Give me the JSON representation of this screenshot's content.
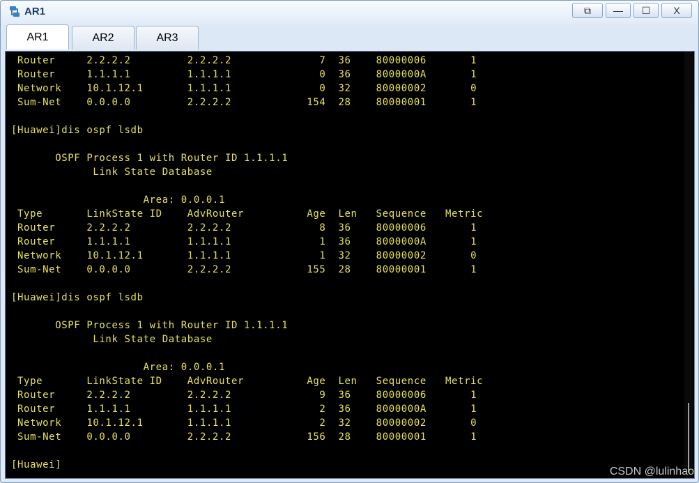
{
  "window": {
    "title": "AR1"
  },
  "controls": {
    "restore": "⧉",
    "minimize": "—",
    "maximize": "☐",
    "close": "X"
  },
  "tabs": [
    {
      "label": "AR1"
    },
    {
      "label": "AR2"
    },
    {
      "label": "AR3"
    }
  ],
  "terminal": {
    "lines": [
      " Router     2.2.2.2         2.2.2.2              7  36    80000006       1",
      " Router     1.1.1.1         1.1.1.1              0  36    8000000A       1",
      " Network    10.1.12.1       1.1.1.1              0  32    80000002       0",
      " Sum-Net    0.0.0.0         2.2.2.2            154  28    80000001       1",
      "",
      "[Huawei]dis ospf lsdb",
      "",
      "       OSPF Process 1 with Router ID 1.1.1.1",
      "             Link State Database",
      "",
      "                     Area: 0.0.0.1",
      " Type       LinkState ID    AdvRouter          Age  Len   Sequence   Metric",
      " Router     2.2.2.2         2.2.2.2              8  36    80000006       1",
      " Router     1.1.1.1         1.1.1.1              1  36    8000000A       1",
      " Network    10.1.12.1       1.1.1.1              1  32    80000002       0",
      " Sum-Net    0.0.0.0         2.2.2.2            155  28    80000001       1",
      "",
      "[Huawei]dis ospf lsdb",
      "",
      "       OSPF Process 1 with Router ID 1.1.1.1",
      "             Link State Database",
      "",
      "                     Area: 0.0.0.1",
      " Type       LinkState ID    AdvRouter          Age  Len   Sequence   Metric",
      " Router     2.2.2.2         2.2.2.2              9  36    80000006       1",
      " Router     1.1.1.1         1.1.1.1              2  36    8000000A       1",
      " Network    10.1.12.1       1.1.1.1              2  32    80000002       0",
      " Sum-Net    0.0.0.0         2.2.2.2            156  28    80000001       1",
      "",
      "[Huawei]"
    ]
  },
  "watermark": "CSDN @lulinhao",
  "colors": {
    "terminal_bg": "#000000",
    "terminal_text": "#e8e25a",
    "accent": "#1a3a6a"
  }
}
